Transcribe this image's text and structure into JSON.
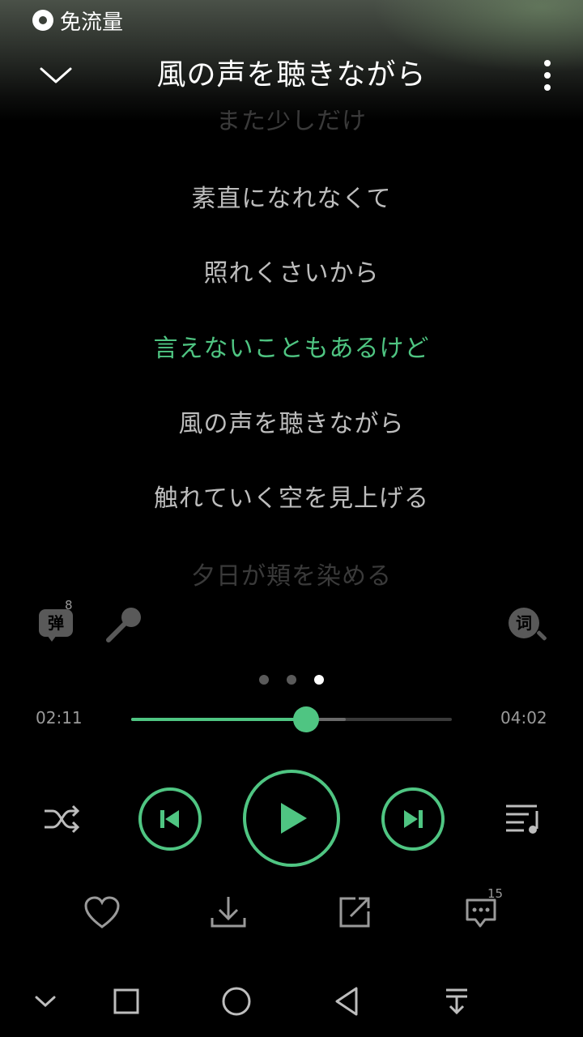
{
  "status_bar": {
    "free_traffic_label": "免流量"
  },
  "header": {
    "title": "風の声を聴きながら"
  },
  "lyrics": {
    "lines": [
      "また少しだけ",
      "素直になれなくて",
      "照れくさいから",
      "言えないこともあるけど",
      "風の声を聴きながら",
      "触れていく空を見上げる",
      "夕日が頬を染める"
    ],
    "current_index": 3
  },
  "tools": {
    "danmaku_label": "弹",
    "danmaku_count": "8",
    "lyric_search_label": "词"
  },
  "pager": {
    "count": 3,
    "active": 2
  },
  "progress": {
    "elapsed": "02:11",
    "total": "04:02",
    "played_fraction": 0.545,
    "buffered_fraction": 0.67
  },
  "actions": {
    "comment_count": "15"
  },
  "colors": {
    "accent": "#4fc582",
    "background": "#000000",
    "muted": "#5a5a5a"
  }
}
